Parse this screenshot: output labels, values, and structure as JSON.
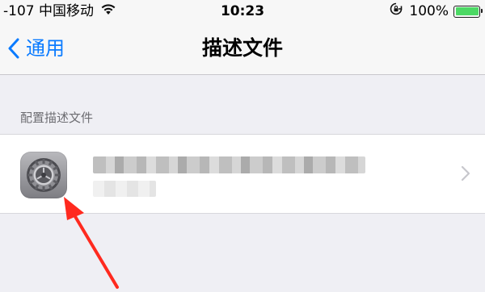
{
  "status_bar": {
    "signal_carrier": "-107 中国移动",
    "time": "10:23",
    "battery_percent": "100%",
    "battery_level": 1.0,
    "battery_color": "#4cd964"
  },
  "nav": {
    "back_label": "通用",
    "title": "描述文件",
    "accent_color": "#0a7bff"
  },
  "section": {
    "header": "配置描述文件"
  },
  "profile": {
    "icon": "settings-gear-icon",
    "name_redacted": true
  },
  "annotation": {
    "arrow_color": "#ff2a1f"
  }
}
